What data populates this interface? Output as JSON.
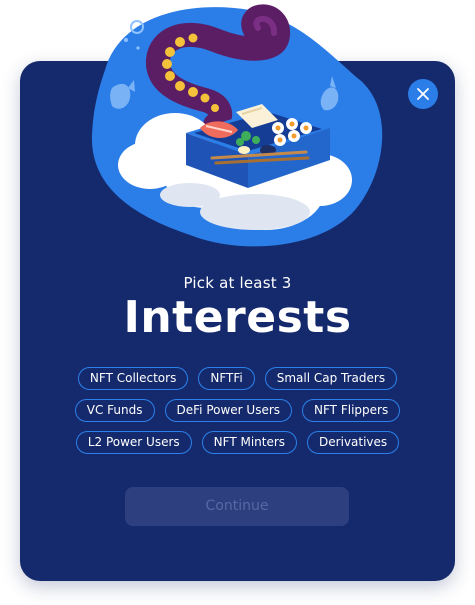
{
  "modal": {
    "subtitle": "Pick at least 3",
    "title": "Interests",
    "continue_label": "Continue",
    "close_icon": "close-icon",
    "interests": [
      [
        "NFT Collectors",
        "NFTFi",
        "Small Cap Traders"
      ],
      [
        "VC Funds",
        "DeFi Power Users",
        "NFT Flippers"
      ],
      [
        "L2 Power Users",
        "NFT Minters",
        "Derivatives"
      ]
    ]
  },
  "colors": {
    "card_bg": "#152a6c",
    "accent": "#2c80ea",
    "button_disabled_bg": "#2e3f7f",
    "button_disabled_text": "#5768a3"
  }
}
